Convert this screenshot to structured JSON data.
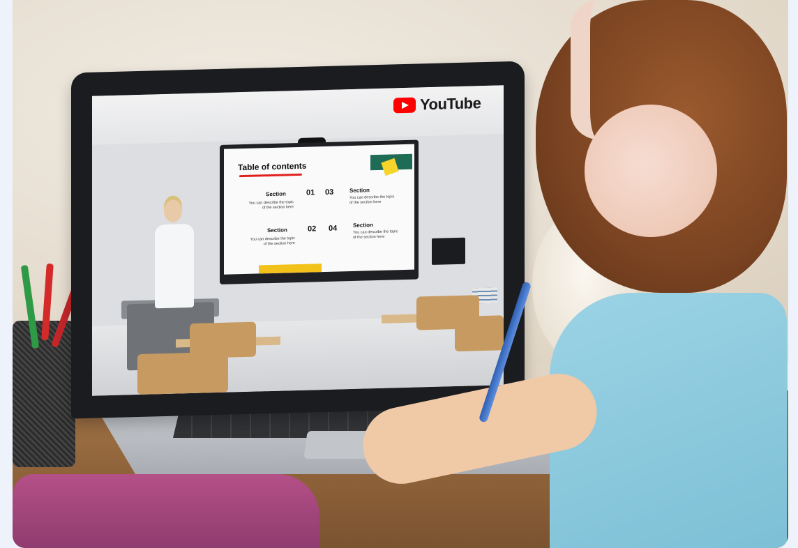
{
  "screen": {
    "brand": "YouTube",
    "slide": {
      "title": "Table of contents",
      "items": [
        {
          "section": "Section",
          "number": "01",
          "desc": "You can describe the topic of the section here"
        },
        {
          "section": "Section",
          "number": "03",
          "desc": "You can describe the topic of the section here"
        },
        {
          "section": "Section",
          "number": "02",
          "desc": "You can describe the topic of the section here"
        },
        {
          "section": "Section",
          "number": "04",
          "desc": "You can describe the topic of the section here"
        }
      ]
    }
  },
  "colors": {
    "youtube_red": "#ff0000",
    "accent_green": "#1e6b56",
    "accent_yellow": "#f2c21b",
    "shirt": "#8fcadc"
  }
}
